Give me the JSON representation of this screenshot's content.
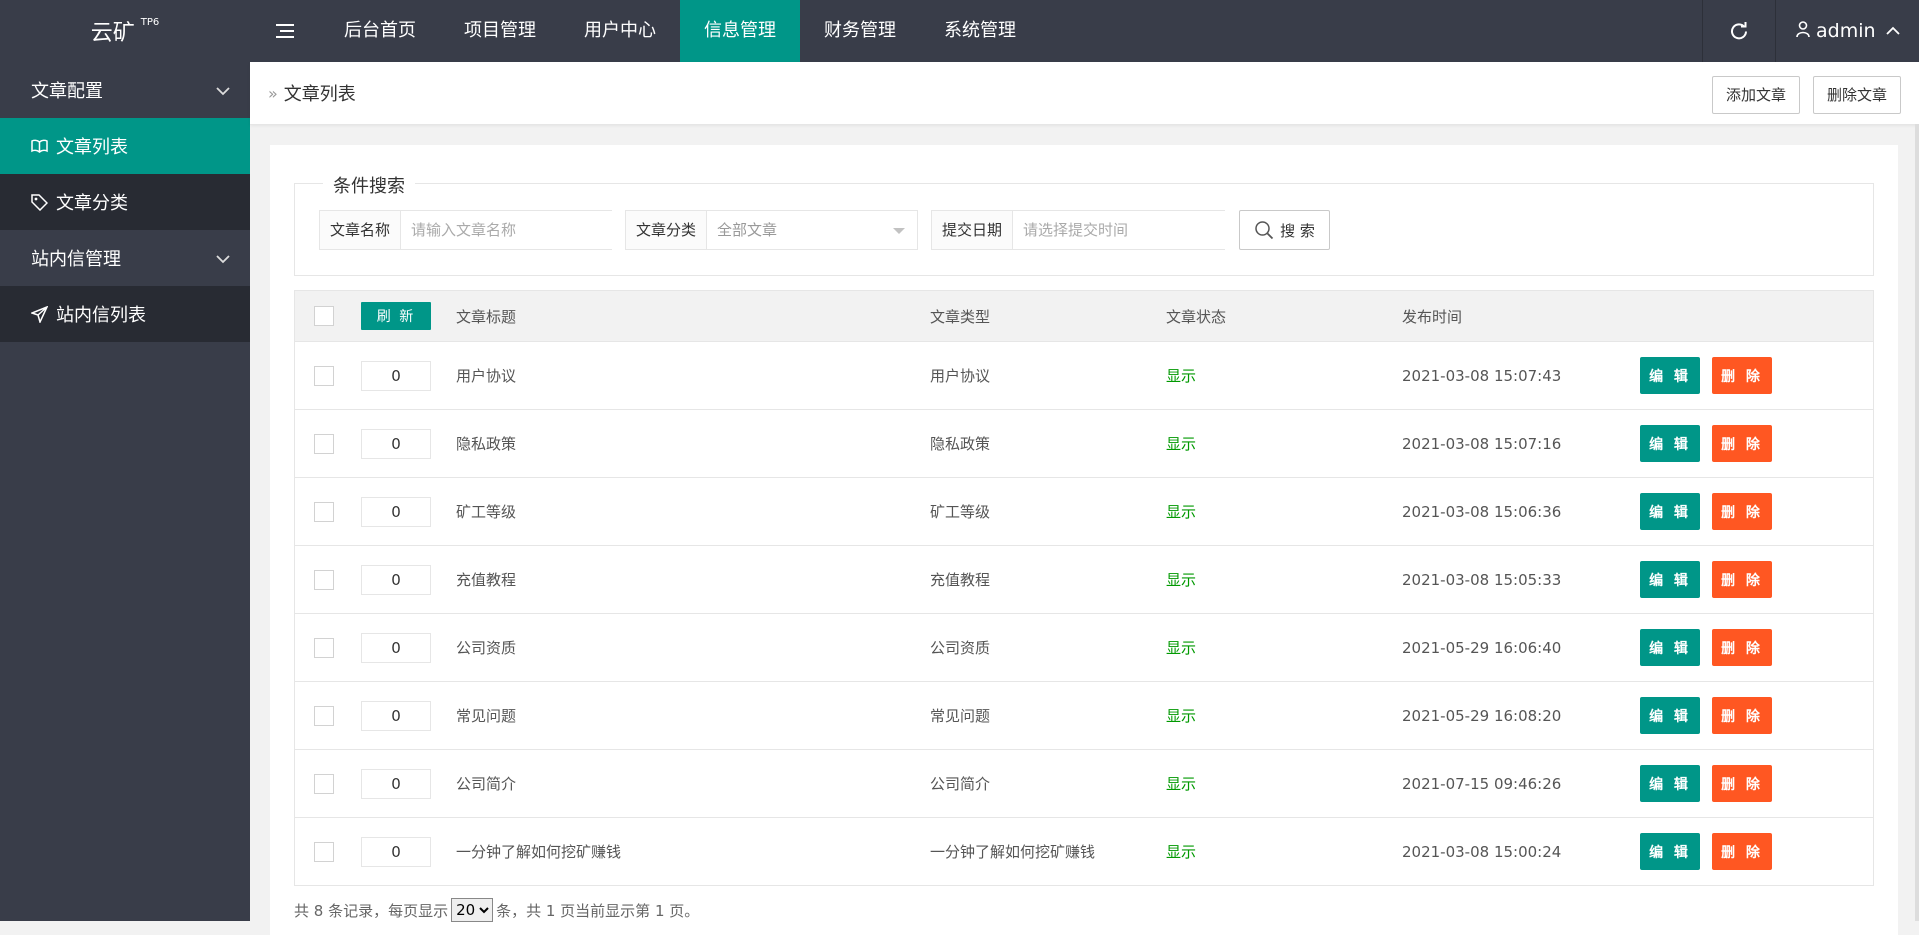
{
  "logo": {
    "main": "云矿",
    "sup": "TP6"
  },
  "nav": [
    {
      "label": "后台首页",
      "active": false
    },
    {
      "label": "项目管理",
      "active": false
    },
    {
      "label": "用户中心",
      "active": false
    },
    {
      "label": "信息管理",
      "active": true
    },
    {
      "label": "财务管理",
      "active": false
    },
    {
      "label": "系统管理",
      "active": false
    }
  ],
  "user": {
    "name": "admin"
  },
  "sidebar": {
    "group1": "文章配置",
    "item1": "文章列表",
    "item2": "文章分类",
    "group2": "站内信管理",
    "item3": "站内信列表"
  },
  "page": {
    "breadcrumb": "文章列表",
    "add_label": "添加文章",
    "delete_label": "删除文章"
  },
  "search": {
    "legend": "条件搜索",
    "name_label": "文章名称",
    "name_placeholder": "请输入文章名称",
    "category_label": "文章分类",
    "category_value": "全部文章",
    "date_label": "提交日期",
    "date_placeholder": "请选择提交时间",
    "button": "搜 索"
  },
  "table": {
    "refresh_label": "刷 新",
    "headers": {
      "title": "文章标题",
      "type": "文章类型",
      "status": "文章状态",
      "time": "发布时间"
    },
    "edit_label": "编 辑",
    "delete_label": "删 除",
    "rows": [
      {
        "sort": "0",
        "title": "用户协议",
        "type": "用户协议",
        "status": "显示",
        "time": "2021-03-08 15:07:43"
      },
      {
        "sort": "0",
        "title": "隐私政策",
        "type": "隐私政策",
        "status": "显示",
        "time": "2021-03-08 15:07:16"
      },
      {
        "sort": "0",
        "title": "矿工等级",
        "type": "矿工等级",
        "status": "显示",
        "time": "2021-03-08 15:06:36"
      },
      {
        "sort": "0",
        "title": "充值教程",
        "type": "充值教程",
        "status": "显示",
        "time": "2021-03-08 15:05:33"
      },
      {
        "sort": "0",
        "title": "公司资质",
        "type": "公司资质",
        "status": "显示",
        "time": "2021-05-29 16:06:40"
      },
      {
        "sort": "0",
        "title": "常见问题",
        "type": "常见问题",
        "status": "显示",
        "time": "2021-05-29 16:08:20"
      },
      {
        "sort": "0",
        "title": "公司简介",
        "type": "公司简介",
        "status": "显示",
        "time": "2021-07-15 09:46:26"
      },
      {
        "sort": "0",
        "title": "一分钟了解如何挖矿赚钱",
        "type": "一分钟了解如何挖矿赚钱",
        "status": "显示",
        "time": "2021-03-08 15:00:24"
      }
    ]
  },
  "pager": {
    "prefix": "共 8 条记录，每页显示",
    "per_page": "20",
    "suffix": "条，共 1 页当前显示第 1 页。"
  },
  "colors": {
    "primary": "#009688",
    "danger": "#ff5722",
    "dark": "#393d49",
    "status_ok": "#009900"
  }
}
